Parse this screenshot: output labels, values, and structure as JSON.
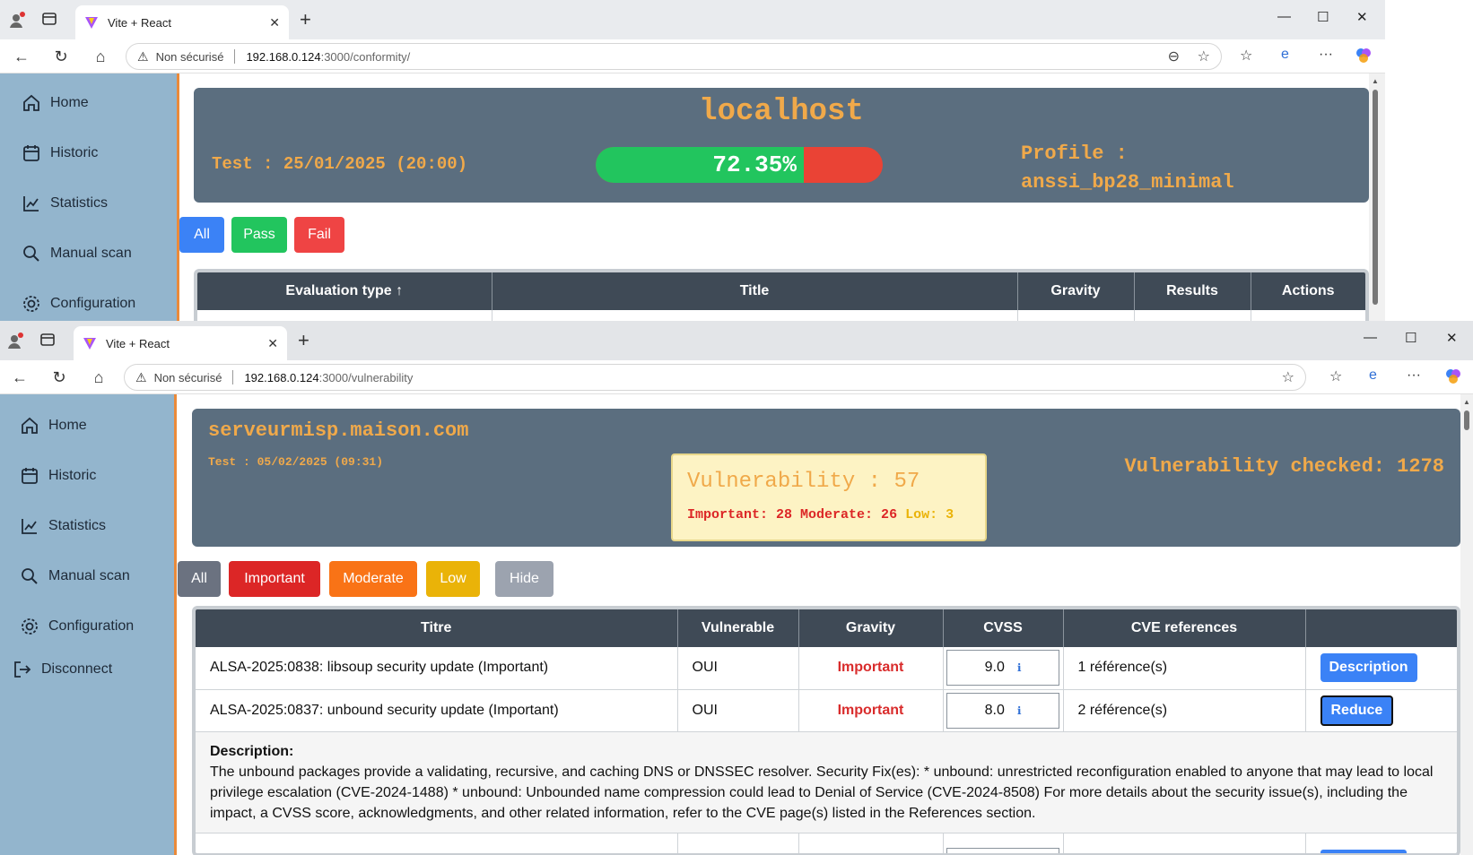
{
  "windows": [
    {
      "tab_title": "Vite + React",
      "url_security": "Non sécurisé",
      "url_host": "192.168.0.124",
      "url_path": ":3000/conformity/",
      "sidebar": [
        "Home",
        "Historic",
        "Statistics",
        "Manual scan",
        "Configuration"
      ],
      "banner": {
        "host": "localhost",
        "test_label": "Test : 25/01/2025 (20:00)",
        "progress_text": "72.35%",
        "progress_value": 72.35,
        "profile_line1": "Profile :",
        "profile_line2": "anssi_bp28_minimal"
      },
      "filters": [
        "All",
        "Pass",
        "Fail"
      ],
      "table_headers": [
        "Evaluation type ↑",
        "Title",
        "Gravity",
        "Results",
        "Actions"
      ]
    },
    {
      "tab_title": "Vite + React",
      "url_security": "Non sécurisé",
      "url_host": "192.168.0.124",
      "url_path": ":3000/vulnerability",
      "sidebar": [
        "Home",
        "Historic",
        "Statistics",
        "Manual scan",
        "Configuration"
      ],
      "disconnect": "Disconnect",
      "banner": {
        "host": "serveurmisp.maison.com",
        "test_label": "Test : 05/02/2025 (09:31)",
        "vuln_title": "Vulnerability : 57",
        "important": "Important: 28",
        "moderate": "Moderate: 26",
        "low": "Low: 3",
        "checked": "Vulnerability checked: 1278"
      },
      "filters": [
        "All",
        "Important",
        "Moderate",
        "Low",
        "Hide"
      ],
      "table_headers": [
        "Titre",
        "Vulnerable",
        "Gravity",
        "CVSS",
        "CVE references",
        ""
      ],
      "rows": [
        {
          "title": "ALSA-2025:0838: libsoup security update (Important)",
          "vulnerable": "OUI",
          "gravity": "Important",
          "cvss": "9.0",
          "refs": "1 référence(s)",
          "action": "Description"
        },
        {
          "title": "ALSA-2025:0837: unbound security update (Important)",
          "vulnerable": "OUI",
          "gravity": "Important",
          "cvss": "8.0",
          "refs": "2 référence(s)",
          "action": "Reduce"
        }
      ],
      "description_label": "Description:",
      "description_text": "The unbound packages provide a validating, recursive, and caching DNS or DNSSEC resolver. Security Fix(es): * unbound: unrestricted reconfiguration enabled to anyone that may lead to local privilege escalation (CVE-2024-1488) * unbound: Unbounded name compression could lead to Denial of Service (CVE-2024-8508) For more details about the security issue(s), including the impact, a CVSS score, acknowledgments, and other related information, refer to the CVE page(s) listed in the References section."
    }
  ],
  "colors": {
    "sidebar": "#93b5cd",
    "banner": "#5b6e7f",
    "accent_orange": "#f0a94a",
    "pass_green": "#22c55e",
    "fail_red": "#ef4444",
    "all_blue": "#3b82f6",
    "important": "#dc2626",
    "moderate": "#f97316",
    "low": "#eab308",
    "hide": "#9ca3af"
  }
}
